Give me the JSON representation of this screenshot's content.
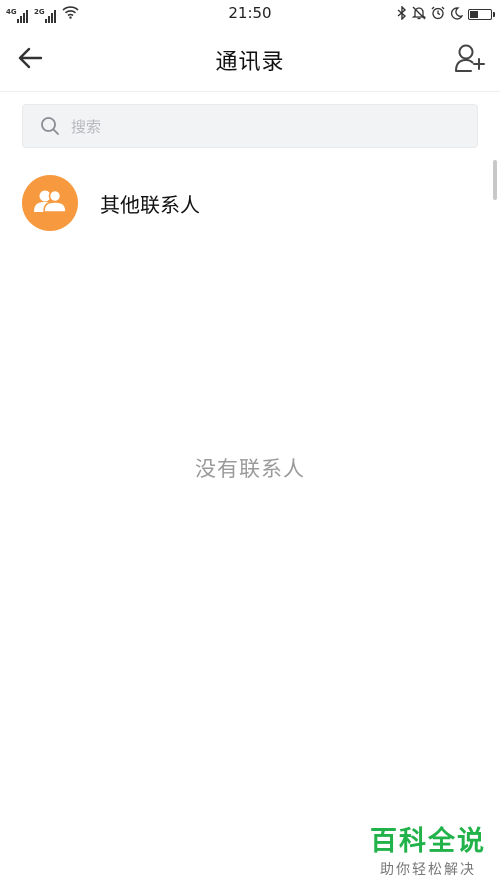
{
  "status_bar": {
    "network_1": "4G",
    "network_2": "2G",
    "time": "21:50",
    "icons": [
      "signal-icon",
      "wifi-icon",
      "bluetooth-icon",
      "mute-icon",
      "alarm-icon",
      "moon-icon",
      "battery-icon"
    ],
    "battery_level": 0.4
  },
  "header": {
    "title": "通讯录",
    "back_icon": "arrow-left-icon",
    "add_icon": "add-user-icon"
  },
  "search": {
    "placeholder": "搜索",
    "value": ""
  },
  "list": {
    "items": [
      {
        "label": "其他联系人",
        "icon": "group-icon",
        "color": "#f7993e"
      }
    ]
  },
  "empty_state": {
    "text": "没有联系人"
  },
  "watermark": {
    "title": "百科全说",
    "subtitle": "助你轻松解决"
  },
  "colors": {
    "accent": "#f7993e",
    "watermark": "#21b24a"
  }
}
